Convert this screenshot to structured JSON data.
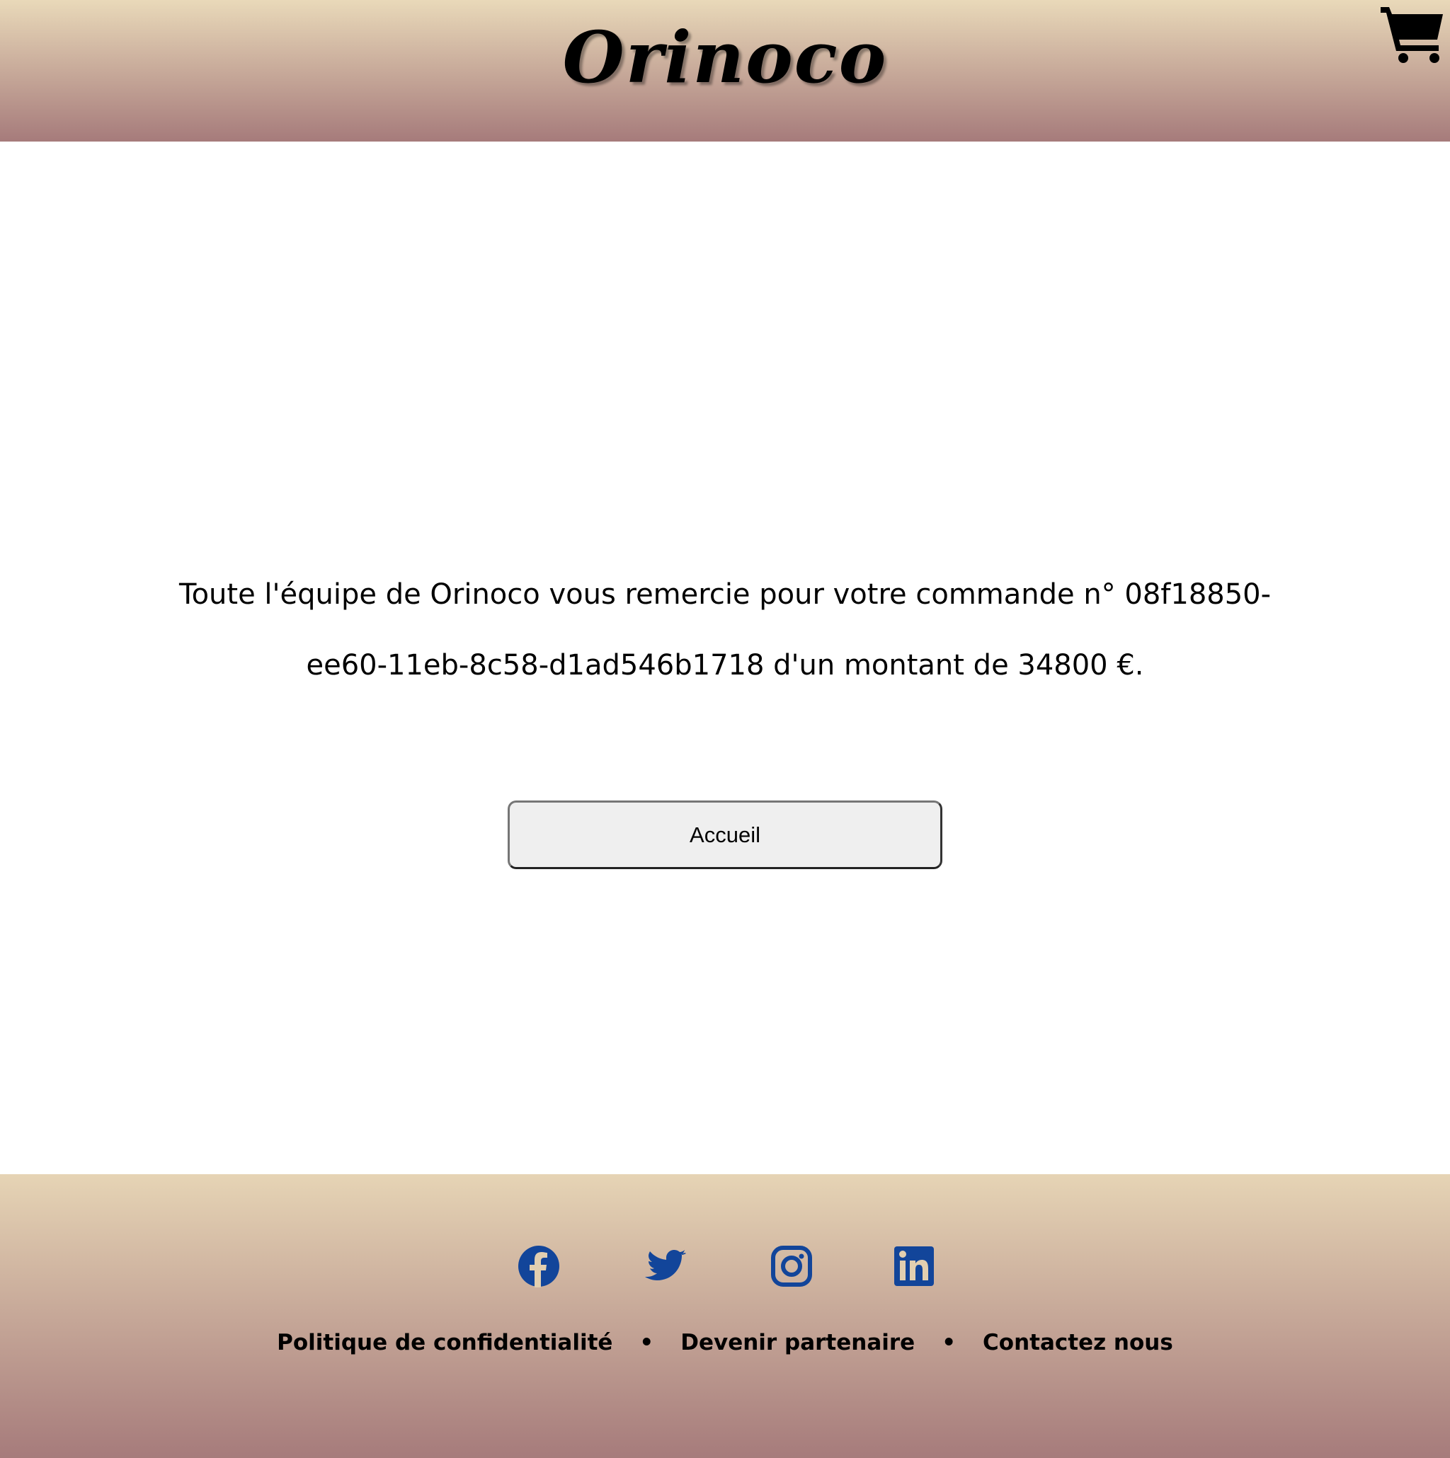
{
  "header": {
    "logo": "Orinoco",
    "cart_icon": "shopping-cart-icon"
  },
  "confirmation": {
    "line1": "Toute l'équipe de Orinoco vous remercie pour votre commande n° 08f18850-",
    "line2": "ee60-11eb-8c58-d1ad546b1718 d'un montant de 34800 €."
  },
  "home_button": {
    "label": "Accueil"
  },
  "footer": {
    "social": [
      "facebook-icon",
      "twitter-icon",
      "instagram-icon",
      "linkedin-icon"
    ],
    "social_color": "#12459a",
    "links": [
      "Politique de confidentialité",
      "Devenir partenaire",
      "Contactez nous"
    ],
    "separator": "•"
  },
  "colors": {
    "gradient_top": "#e9d9b9",
    "gradient_bottom": "#a67b7b"
  }
}
